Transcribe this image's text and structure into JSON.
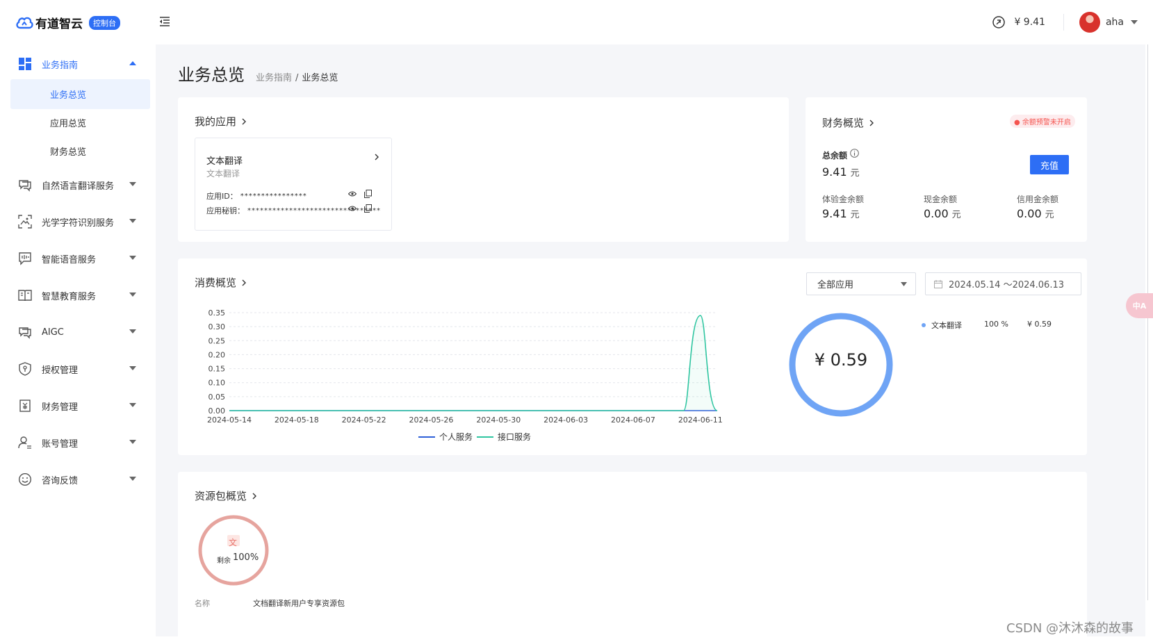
{
  "header": {
    "logo_text": "有道智云",
    "logo_badge": "控制台",
    "balance": "¥ 9.41",
    "username": "aha"
  },
  "sidebar": {
    "items": [
      {
        "label": "业务指南",
        "icon": "dashboard-icon"
      },
      {
        "label": "自然语言翻译服务",
        "icon": "chat-translate-icon"
      },
      {
        "label": "光学字符识别服务",
        "icon": "scan-image-icon"
      },
      {
        "label": "智能语音服务",
        "icon": "voice-icon"
      },
      {
        "label": "智慧教育服务",
        "icon": "book-icon"
      },
      {
        "label": "AIGC",
        "icon": "chat-ai-icon"
      },
      {
        "label": "授权管理",
        "icon": "shield-icon"
      },
      {
        "label": "财务管理",
        "icon": "yen-doc-icon"
      },
      {
        "label": "账号管理",
        "icon": "user-settings-icon"
      },
      {
        "label": "咨询反馈",
        "icon": "smile-icon"
      }
    ],
    "subitems": [
      {
        "label": "业务总览"
      },
      {
        "label": "应用总览"
      },
      {
        "label": "财务总览"
      }
    ]
  },
  "page": {
    "title": "业务总览",
    "breadcrumb": [
      "业务指南",
      "/",
      "业务总览"
    ]
  },
  "my_apps": {
    "title": "我的应用",
    "app_name": "文本翻译",
    "app_sub": "文本翻译",
    "id_label": "应用ID：",
    "id_mask": "****************",
    "secret_label": "应用秘钥：",
    "secret_mask": "********************************"
  },
  "finance": {
    "title": "财务概览",
    "warn_badge": "● 余额预警未开启",
    "total_label": "总余额",
    "total_value": "9.41",
    "unit": "元",
    "recharge_label": "充值",
    "trial_label": "体验金余额",
    "trial_value": "9.41",
    "cash_label": "现金余额",
    "cash_value": "0.00",
    "credit_label": "信用金余额",
    "credit_value": "0.00"
  },
  "consumption": {
    "title": "消费概览",
    "app_select": "全部应用",
    "date_range": "2024.05.14 ～2024.06.13",
    "donut_total": "¥ 0.59",
    "pie_name": "文本翻译",
    "pie_percent": "100 %",
    "pie_amount": "¥ 0.59"
  },
  "chart_data": {
    "type": "line",
    "x": [
      "2024-05-14",
      "2024-05-15",
      "2024-05-16",
      "2024-05-17",
      "2024-05-18",
      "2024-05-19",
      "2024-05-20",
      "2024-05-21",
      "2024-05-22",
      "2024-05-23",
      "2024-05-24",
      "2024-05-25",
      "2024-05-26",
      "2024-05-27",
      "2024-05-28",
      "2024-05-29",
      "2024-05-30",
      "2024-05-31",
      "2024-06-01",
      "2024-06-02",
      "2024-06-03",
      "2024-06-04",
      "2024-06-05",
      "2024-06-06",
      "2024-06-07",
      "2024-06-08",
      "2024-06-09",
      "2024-06-10",
      "2024-06-11",
      "2024-06-12"
    ],
    "xticks": [
      "2024-05-14",
      "2024-05-18",
      "2024-05-22",
      "2024-05-26",
      "2024-05-30",
      "2024-06-03",
      "2024-06-07",
      "2024-06-11"
    ],
    "yticks": [
      "0.35",
      "0.30",
      "0.25",
      "0.20",
      "0.15",
      "0.10",
      "0.05",
      "0.00"
    ],
    "ylim": [
      0,
      0.35
    ],
    "series": [
      {
        "name": "个人服务",
        "color": "#2d5fd8",
        "values": [
          0,
          0,
          0,
          0,
          0,
          0,
          0,
          0,
          0,
          0,
          0,
          0,
          0,
          0,
          0,
          0,
          0,
          0,
          0,
          0,
          0,
          0,
          0,
          0,
          0,
          0,
          0,
          0,
          0,
          0
        ]
      },
      {
        "name": "接口服务",
        "color": "#2ec5a0",
        "values": [
          0,
          0,
          0,
          0,
          0,
          0,
          0,
          0,
          0,
          0,
          0,
          0,
          0,
          0,
          0,
          0,
          0,
          0,
          0,
          0,
          0,
          0,
          0,
          0,
          0,
          0,
          0,
          0,
          0.34,
          0
        ]
      }
    ],
    "grid": true,
    "legend": "bottom"
  },
  "packages": {
    "title": "资源包概览",
    "icon_char": "文",
    "remain_label": "剩余",
    "remain_value": "100%",
    "name_label": "名称",
    "name_value": "文档翻译新用户专享资源包"
  },
  "float_button": "中A",
  "watermark": "CSDN @沐沐森的故事"
}
